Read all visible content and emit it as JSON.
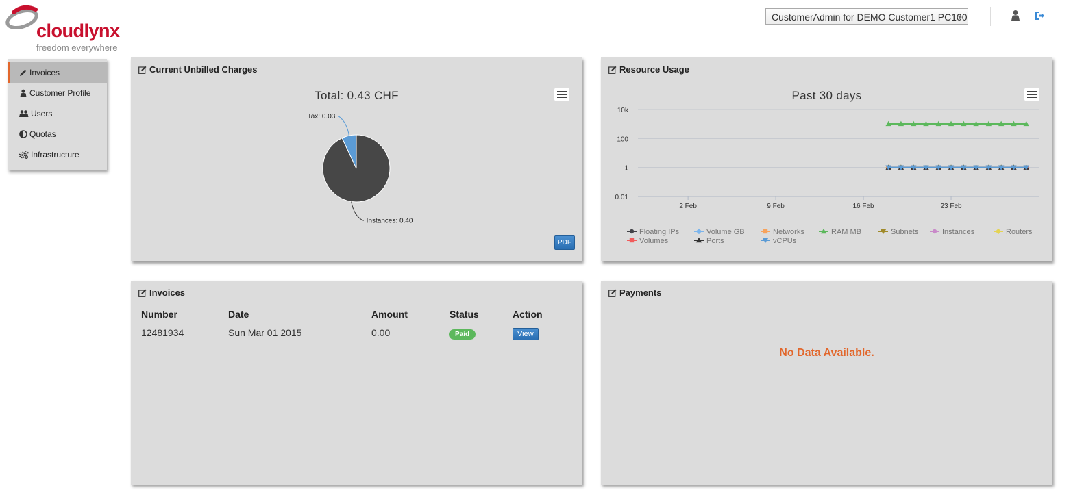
{
  "brand": {
    "name": "cloudlynx",
    "tagline": "freedom everywhere"
  },
  "header": {
    "account_selector": "CustomerAdmin for DEMO Customer1 PC100",
    "user_icon": "user-icon",
    "logout_icon": "sign-out-icon"
  },
  "sidebar": {
    "items": [
      {
        "label": "Invoices",
        "icon": "pencil-icon",
        "active": true
      },
      {
        "label": "Customer Profile",
        "icon": "user-icon"
      },
      {
        "label": "Users",
        "icon": "users-icon"
      },
      {
        "label": "Quotas",
        "icon": "adjust-icon"
      },
      {
        "label": "Infrastructure",
        "icon": "cogs-icon"
      }
    ]
  },
  "unbilled": {
    "title": "Current Unbilled Charges",
    "pdf_label": "PDF",
    "chart_data": {
      "type": "pie",
      "title": "Total: 0.43 CHF",
      "slices": [
        {
          "label": "Instances",
          "display": "Instances: 0.40",
          "value": 0.4,
          "color": "#474747"
        },
        {
          "label": "Tax",
          "display": "Tax: 0.03",
          "value": 0.03,
          "color": "#5b9bd5"
        }
      ]
    }
  },
  "resource_usage": {
    "title": "Resource Usage",
    "chart_data": {
      "type": "line",
      "title": "Past 30 days",
      "y_scale": "log",
      "ylim": [
        0.01,
        10000
      ],
      "y_ticks": [
        "10k",
        "100",
        "1",
        "0.01"
      ],
      "x_ticks": [
        "2 Feb",
        "9 Feb",
        "16 Feb",
        "23 Feb"
      ],
      "x_dates": [
        "2015-02-18",
        "2015-02-19",
        "2015-02-20",
        "2015-02-21",
        "2015-02-22",
        "2015-02-23",
        "2015-02-24",
        "2015-02-25",
        "2015-02-26",
        "2015-02-27",
        "2015-02-28",
        "2015-03-01"
      ],
      "series": [
        {
          "name": "Floating IPs",
          "color": "#434348",
          "marker": "circle",
          "values": [
            1,
            1,
            1,
            1,
            1,
            1,
            1,
            1,
            1,
            1,
            1,
            1
          ]
        },
        {
          "name": "Volume GB",
          "color": "#7cb5ec",
          "marker": "diamond",
          "values": [
            1,
            1,
            1,
            1,
            1,
            1,
            1,
            1,
            1,
            1,
            1,
            1
          ]
        },
        {
          "name": "Networks",
          "color": "#f7a35c",
          "marker": "square",
          "values": [
            1,
            1,
            1,
            1,
            1,
            1,
            1,
            1,
            1,
            1,
            1,
            1
          ]
        },
        {
          "name": "RAM MB",
          "color": "#5cb85c",
          "marker": "triangle",
          "values": [
            1024,
            1024,
            1024,
            1024,
            1024,
            1024,
            1024,
            1024,
            1024,
            1024,
            1024,
            1024
          ]
        },
        {
          "name": "Subnets",
          "color": "#a08a2a",
          "marker": "triangle-down",
          "values": [
            1,
            1,
            1,
            1,
            1,
            1,
            1,
            1,
            1,
            1,
            1,
            1
          ]
        },
        {
          "name": "Instances",
          "color": "#c98ac9",
          "marker": "circle",
          "values": [
            1,
            1,
            1,
            1,
            1,
            1,
            1,
            1,
            1,
            1,
            1,
            1
          ]
        },
        {
          "name": "Routers",
          "color": "#e4d354",
          "marker": "diamond",
          "values": [
            1,
            1,
            1,
            1,
            1,
            1,
            1,
            1,
            1,
            1,
            1,
            1
          ]
        },
        {
          "name": "Volumes",
          "color": "#f15c5c",
          "marker": "square",
          "values": [
            1,
            1,
            1,
            1,
            1,
            1,
            1,
            1,
            1,
            1,
            1,
            1
          ]
        },
        {
          "name": "Ports",
          "color": "#333333",
          "marker": "triangle",
          "values": [
            1,
            1,
            1,
            1,
            1,
            1,
            1,
            1,
            1,
            1,
            1,
            1
          ]
        },
        {
          "name": "vCPUs",
          "color": "#5b9bd5",
          "marker": "triangle-down",
          "values": [
            1,
            1,
            1,
            1,
            1,
            1,
            1,
            1,
            1,
            1,
            1,
            1
          ]
        }
      ]
    }
  },
  "invoices": {
    "title": "Invoices",
    "columns": [
      "Number",
      "Date",
      "Amount",
      "Status",
      "Action"
    ],
    "rows": [
      {
        "number": "12481934",
        "date": "Sun Mar 01 2015",
        "amount": "0.00",
        "status": "Paid",
        "action": "View"
      }
    ]
  },
  "payments": {
    "title": "Payments",
    "empty_message": "No Data Available."
  },
  "colors": {
    "brand": "#c8102e",
    "accent": "#e2672c",
    "panel_bg": "#dcdcdc",
    "button_blue": "#2a6fb3",
    "paid_green": "#5cb85c"
  }
}
